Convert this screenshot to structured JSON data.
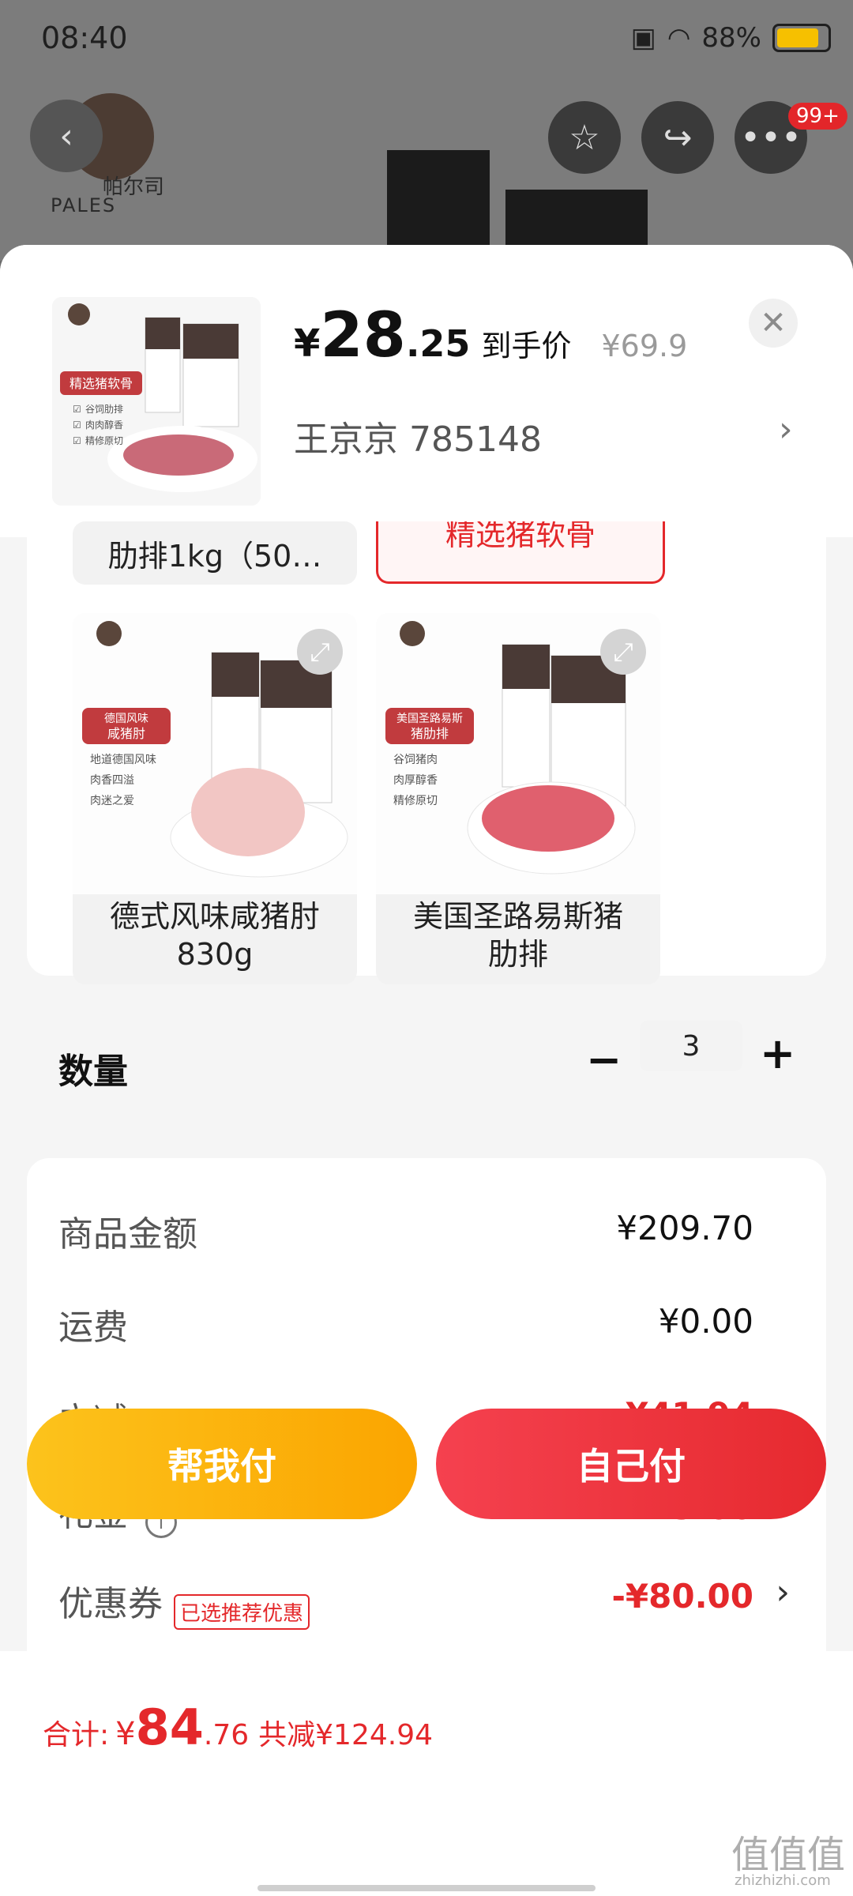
{
  "status_bar": {
    "time": "08:40",
    "battery": "88%"
  },
  "background_page": {
    "brand_cn": "帕尔司",
    "brand_en": "PALES",
    "badge": "99+"
  },
  "product_header": {
    "price_symbol": "¥",
    "price_integer": "28",
    "price_decimal": ".25",
    "price_tag": "到手价",
    "original_price": "¥69.9",
    "user_line": "王京京  785148",
    "thumb_badge": "精选猪软骨",
    "thumb_features": [
      "谷饲肋排",
      "肉肉醇香",
      "精修原切"
    ]
  },
  "variants": {
    "partial_left": "肋排1kg（50…",
    "partial_right": "精选猪软骨",
    "items": [
      {
        "label": "德式风味咸猪肘\n830g",
        "badge_line1": "德国风味",
        "badge_line2": "咸猪肘",
        "features": [
          "地道德国风味",
          "肉香四溢",
          "肉迷之爱"
        ]
      },
      {
        "label": "美国圣路易斯猪\n肋排",
        "badge_line1": "美国圣路易斯",
        "badge_line2": "猪肋排",
        "features": [
          "谷饲猪肉",
          "肉厚醇香",
          "精修原切"
        ]
      }
    ]
  },
  "quantity": {
    "label": "数量",
    "minus": "−",
    "value": "3",
    "plus": "+"
  },
  "summary": {
    "rows": [
      {
        "label": "商品金额",
        "value": "¥209.70"
      },
      {
        "label": "运费",
        "value": "¥0.00"
      },
      {
        "label": "立减",
        "value": "- ¥41.94"
      },
      {
        "label": "礼金",
        "value": "- ¥3.00"
      },
      {
        "label": "优惠券",
        "value": "-¥80.00"
      }
    ],
    "coupon_tag": "已选推荐优惠"
  },
  "footer": {
    "total_label": "合计:",
    "total_yen": "¥",
    "total_big": "84",
    "total_small": ".76",
    "saved": "共减¥124.94",
    "help_pay": "帮我付",
    "self_pay": "自己付"
  },
  "watermark": {
    "main": "值值值",
    "sub": "zhizhizhi.com"
  },
  "colors": {
    "accent_red": "#e4282b",
    "help_yellow": "#fcb40f"
  }
}
